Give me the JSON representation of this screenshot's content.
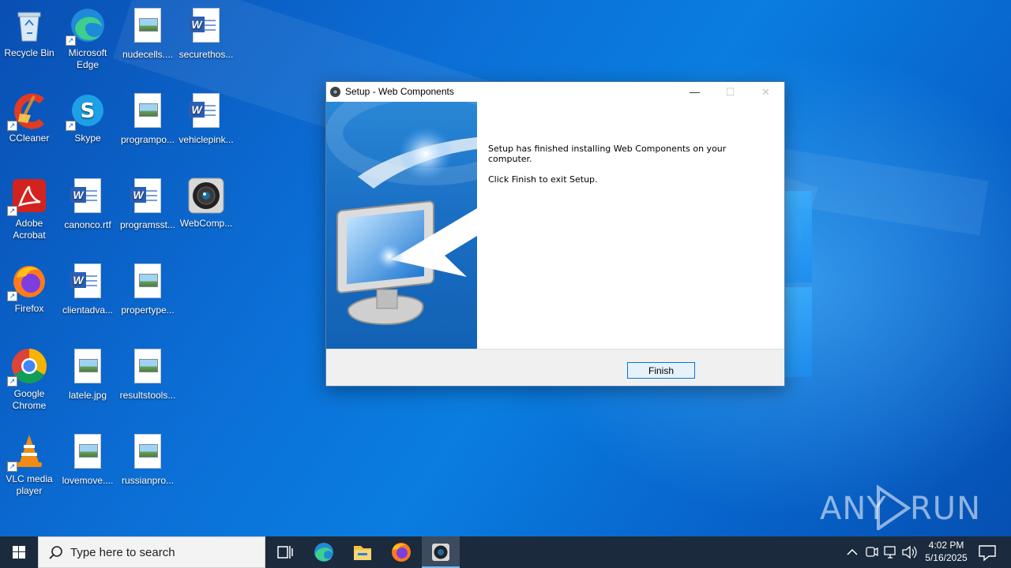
{
  "desktop": {
    "icons": [
      {
        "label": "Recycle Bin",
        "icon": "recycle-bin-icon"
      },
      {
        "label": "Microsoft Edge",
        "icon": "edge-icon"
      },
      {
        "label": "nudecells....",
        "icon": "image-file-icon"
      },
      {
        "label": "securethos...",
        "icon": "word-doc-icon"
      },
      {
        "label": "CCleaner",
        "icon": "ccleaner-icon"
      },
      {
        "label": "Skype",
        "icon": "skype-icon"
      },
      {
        "label": "programpo...",
        "icon": "image-file-icon"
      },
      {
        "label": "vehiclepink...",
        "icon": "word-doc-icon"
      },
      {
        "label": "Adobe Acrobat",
        "icon": "acrobat-icon"
      },
      {
        "label": "canonco.rtf",
        "icon": "word-doc-icon"
      },
      {
        "label": "programsst...",
        "icon": "word-doc-icon"
      },
      {
        "label": "WebComp...",
        "icon": "webcomponents-app-icon"
      },
      {
        "label": "Firefox",
        "icon": "firefox-icon"
      },
      {
        "label": "clientadva...",
        "icon": "word-doc-icon"
      },
      {
        "label": "propertype...",
        "icon": "image-file-icon"
      },
      {
        "label": "Google Chrome",
        "icon": "chrome-icon"
      },
      {
        "label": "latele.jpg",
        "icon": "image-file-icon"
      },
      {
        "label": "resultstools...",
        "icon": "image-file-icon"
      },
      {
        "label": "VLC media player",
        "icon": "vlc-icon"
      },
      {
        "label": "lovemove....",
        "icon": "image-file-icon"
      },
      {
        "label": "russianpro...",
        "icon": "image-file-icon"
      }
    ]
  },
  "setup": {
    "title": "Setup - Web Components",
    "minimize_glyph": "—",
    "maximize_glyph": "☐",
    "close_glyph": "✕",
    "message_line1": "Setup has finished installing Web Components on your computer.",
    "message_line2": "Click Finish to exit Setup.",
    "finish_label": "Finish"
  },
  "watermark": {
    "text": "ANY RUN"
  },
  "taskbar": {
    "search_placeholder": "Type here to search",
    "apps": [
      "task-view-icon",
      "edge-icon",
      "file-explorer-icon",
      "firefox-icon",
      "webcomponents-app-icon"
    ],
    "time": "4:02 PM",
    "date": "5/16/2025"
  },
  "colors": {
    "accent": "#0078d7",
    "taskbar": "#1b2a3c",
    "desktop": "#0a64c8"
  }
}
